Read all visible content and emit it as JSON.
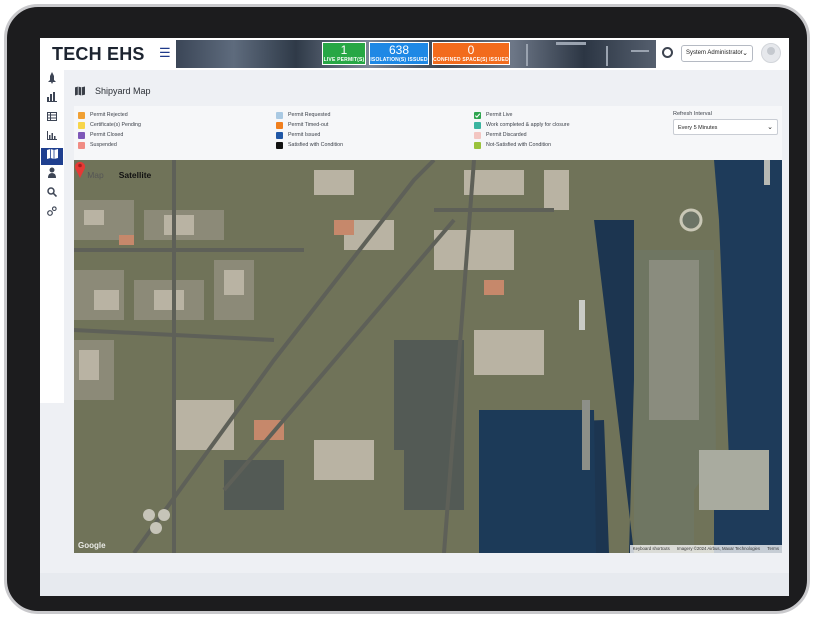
{
  "app": {
    "logo": "TECH EHS"
  },
  "header": {
    "stats": [
      {
        "value": "1",
        "label": "LIVE PERMIT(S)",
        "color": "#27a745"
      },
      {
        "value": "638",
        "label": "ISOLATION(S) ISSUED",
        "color": "#1e88e5"
      },
      {
        "value": "0",
        "label": "CONFINED SPACE(S) ISSUED",
        "color": "#f26b1d"
      }
    ],
    "user_role": "System Administrator"
  },
  "sidebar": {
    "items": [
      {
        "icon": "rocket-icon"
      },
      {
        "icon": "bar-chart-icon"
      },
      {
        "icon": "table-icon"
      },
      {
        "icon": "column-chart-icon"
      },
      {
        "icon": "map-icon",
        "active": true
      },
      {
        "icon": "person-icon"
      },
      {
        "icon": "search-icon"
      },
      {
        "icon": "settings-icon"
      }
    ]
  },
  "page": {
    "title": "Shipyard Map"
  },
  "legend": {
    "col1": [
      {
        "label": "Permit Rejected",
        "color": "#f0a033"
      },
      {
        "label": "Certificate(s) Pending",
        "color": "#f7d54a"
      },
      {
        "label": "Permit Closed",
        "color": "#7d57b8"
      },
      {
        "label": "Suspended",
        "color": "#f08c84"
      }
    ],
    "col2": [
      {
        "label": "Permit Requested",
        "color": "#a9c9e3"
      },
      {
        "label": "Permit Timed-out",
        "color": "#f07f1e"
      },
      {
        "label": "Permit Issued",
        "color": "#1f57a6"
      },
      {
        "label": "Satisfied with Condition",
        "color": "#111111"
      }
    ],
    "col3": [
      {
        "label": "Permit Live",
        "color": "#2ea44f"
      },
      {
        "label": "Work completed & apply for closure",
        "color": "#3bb4a0"
      },
      {
        "label": "Permit Discarded",
        "color": "#f3c6c2"
      },
      {
        "label": "Not-Satisfied with Condition",
        "color": "#9ac23c"
      }
    ],
    "help_glyph": "?"
  },
  "refresh": {
    "label": "Refresh Interval",
    "value": "Every 5 Minutes"
  },
  "map": {
    "tabs": [
      "Map",
      "Satellite"
    ],
    "active_tab": "Satellite",
    "logo": "Google",
    "attribution": [
      "Keyboard shortcuts",
      "Imagery ©2024 Airbus, Maxar Technologies",
      "Terms"
    ]
  }
}
